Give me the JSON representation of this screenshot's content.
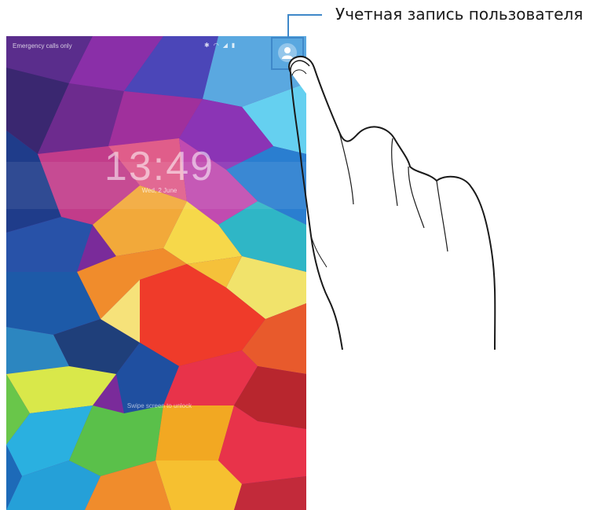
{
  "callout": {
    "label": "Учетная запись пользователя"
  },
  "status_bar": {
    "left_text": "Emergency calls only",
    "icons": [
      "bluetooth-icon",
      "wifi-icon",
      "signal-icon",
      "battery-icon"
    ]
  },
  "lockscreen": {
    "time": "13:49",
    "date": "Wed, 2 June",
    "hint": "Swipe screen to unlock"
  },
  "colors": {
    "callout_accent": "#3f88c9",
    "text": "#1a1a1a"
  }
}
